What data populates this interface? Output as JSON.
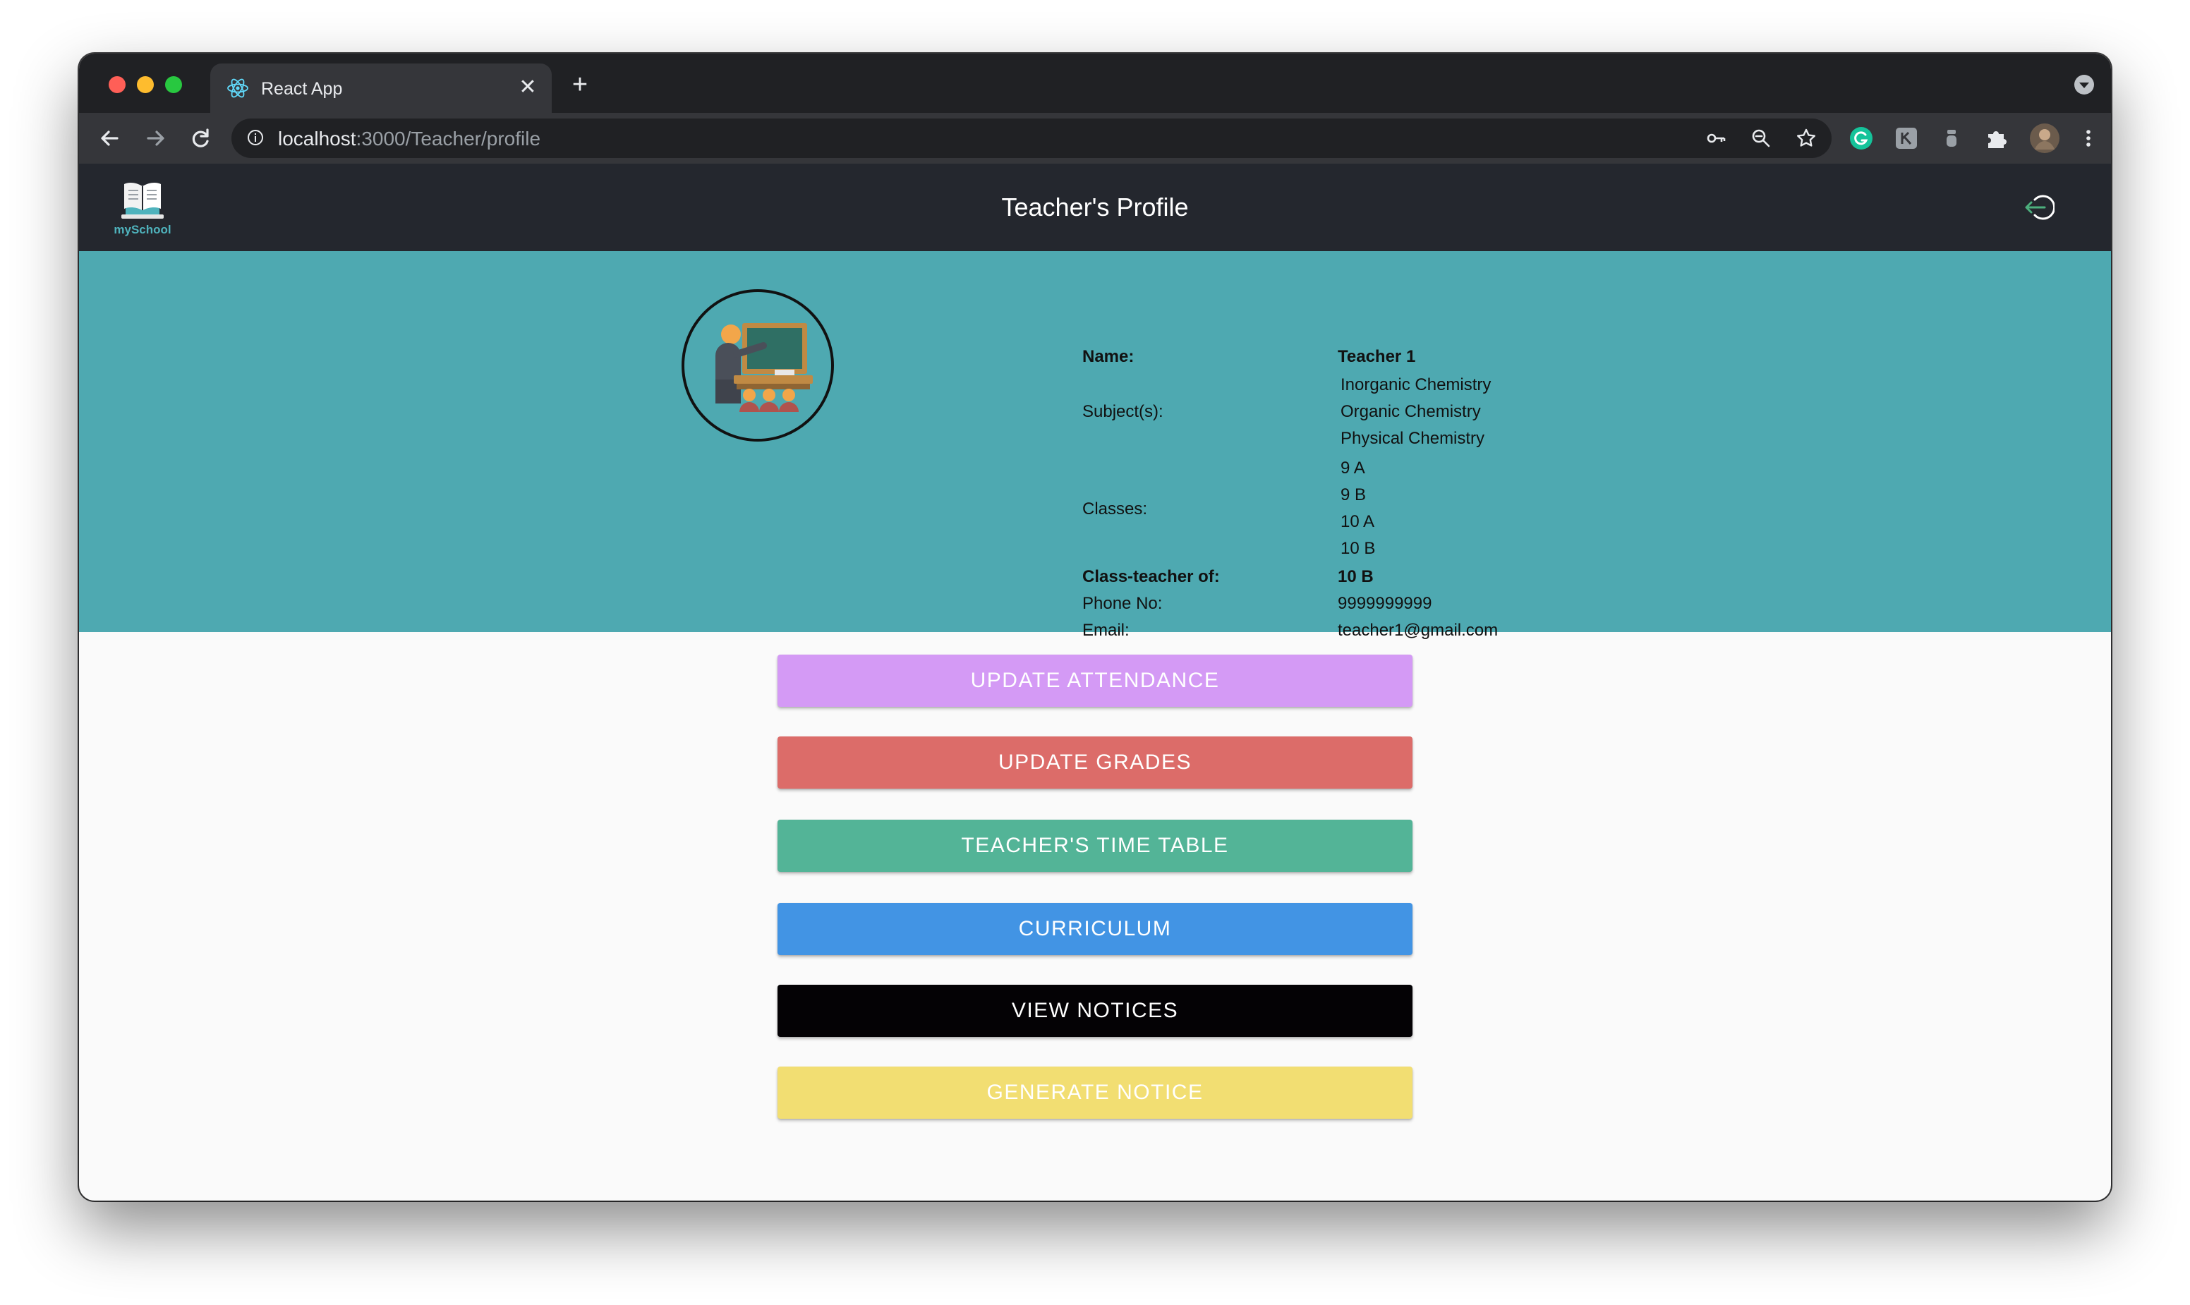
{
  "browser": {
    "tab": {
      "title": "React App",
      "favicon": "react-icon",
      "close_icon": "close-icon",
      "close_glyph": "✕"
    },
    "new_tab_icon": "plus-icon",
    "new_tab_glyph": "+",
    "url": {
      "host": "localhost",
      "path": ":3000/Teacher/profile"
    },
    "nav_icons": [
      "back-arrow-icon",
      "forward-arrow-icon",
      "reload-icon"
    ],
    "omnibox_icons": [
      "info-icon",
      "key-icon",
      "zoom-icon",
      "star-icon"
    ],
    "extension_icons": [
      "grammarly-icon",
      "extension-icon",
      "extension-icon",
      "puzzle-icon",
      "profile-avatar",
      "more-vert-icon"
    ]
  },
  "app": {
    "logo_text": "mySchool",
    "page_title": "Teacher's Profile",
    "logout_icon": "logout-icon"
  },
  "profile": {
    "avatar_icon": "teacher-at-blackboard-icon",
    "name_label": "Name:",
    "name": "Teacher 1",
    "subjects_label": "Subject(s):",
    "subjects": [
      "Inorganic Chemistry",
      "Organic Chemistry",
      "Physical Chemistry"
    ],
    "classes_label": "Classes:",
    "classes": [
      "9 A",
      "9 B",
      "10 A",
      "10 B"
    ],
    "class_teacher_label": "Class-teacher of:",
    "class_teacher_of": "10 B",
    "phone_label": "Phone No:",
    "phone": "9999999999",
    "email_label": "Email:",
    "email": "teacher1@gmail.com"
  },
  "actions": {
    "update_attendance": "UPDATE ATTENDANCE",
    "update_grades": "UPDATE GRADES",
    "time_table": "TEACHER'S TIME TABLE",
    "curriculum": "CURRICULUM",
    "view_notices": "VIEW NOTICES",
    "generate_notice": "GENERATE NOTICE"
  },
  "colors": {
    "header_bg": "#24272e",
    "profile_bg": "#4ea9b1",
    "attendance": "#d49af5",
    "grades": "#dc6c69",
    "time_table": "#53b497",
    "curriculum": "#4294e4",
    "notices": "#040205",
    "generate": "#f2de72"
  }
}
